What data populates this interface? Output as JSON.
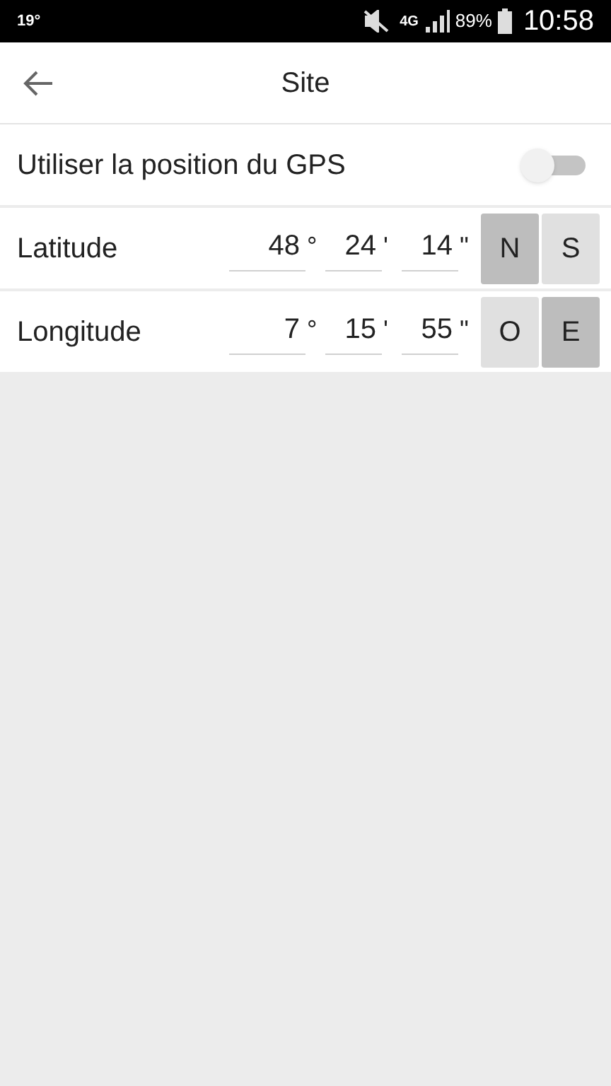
{
  "status_bar": {
    "temperature": "19°",
    "network": "4G",
    "battery": "89%",
    "time": "10:58"
  },
  "toolbar": {
    "title": "Site"
  },
  "gps_toggle": {
    "label": "Utiliser la position du GPS",
    "on": false
  },
  "coordinates": [
    {
      "label": "Latitude",
      "degrees": "48",
      "degree_sign": "°",
      "minutes": "24",
      "minute_sign": "'",
      "seconds": "14",
      "second_sign": "\"",
      "hemispheres": [
        {
          "label": "N",
          "selected": true
        },
        {
          "label": "S",
          "selected": false
        }
      ]
    },
    {
      "label": "Longitude",
      "degrees": "7",
      "degree_sign": "°",
      "minutes": "15",
      "minute_sign": "'",
      "seconds": "55",
      "second_sign": "\"",
      "hemispheres": [
        {
          "label": "O",
          "selected": false
        },
        {
          "label": "E",
          "selected": true
        }
      ]
    }
  ]
}
